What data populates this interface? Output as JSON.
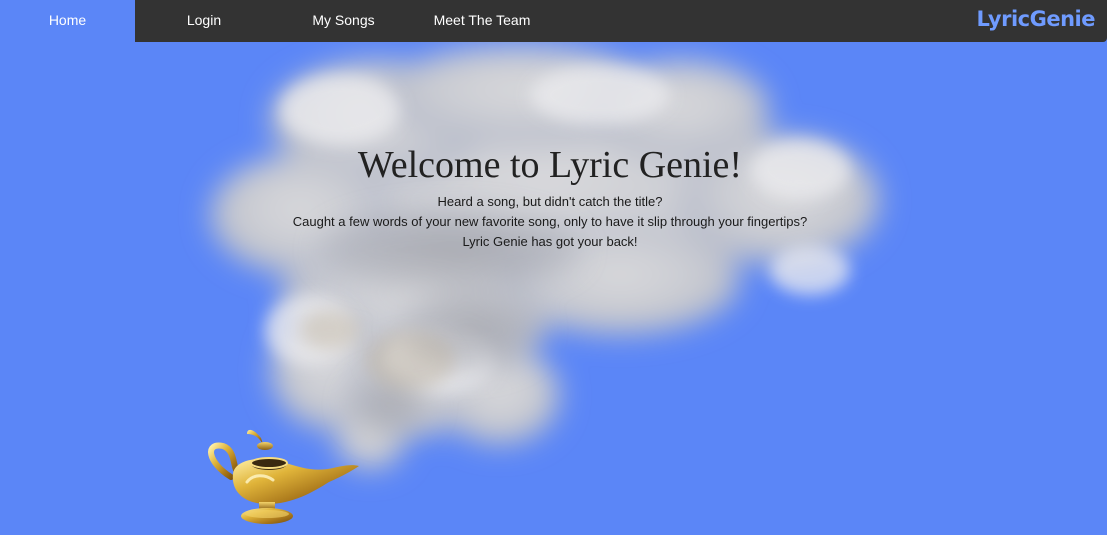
{
  "nav": {
    "items": [
      {
        "label": "Home",
        "active": true
      },
      {
        "label": "Login",
        "active": false
      },
      {
        "label": "My Songs",
        "active": false
      },
      {
        "label": "Meet The Team",
        "active": false
      }
    ],
    "brand": "LyricGenie",
    "brand_color": "#6f9bff",
    "bar_color": "#333333"
  },
  "page": {
    "background_color": "#5b86f7"
  },
  "hero": {
    "title": "Welcome to Lyric Genie!",
    "line1": "Heard a song, but didn't catch the title?",
    "line2": "Caught a few words of your new favorite song, only to have it slip through your fingertips?",
    "line3": "Lyric Genie has got your back!"
  },
  "decor": {
    "cloud": "smoke-cloud-image",
    "lamp": "magic-lamp-image"
  }
}
